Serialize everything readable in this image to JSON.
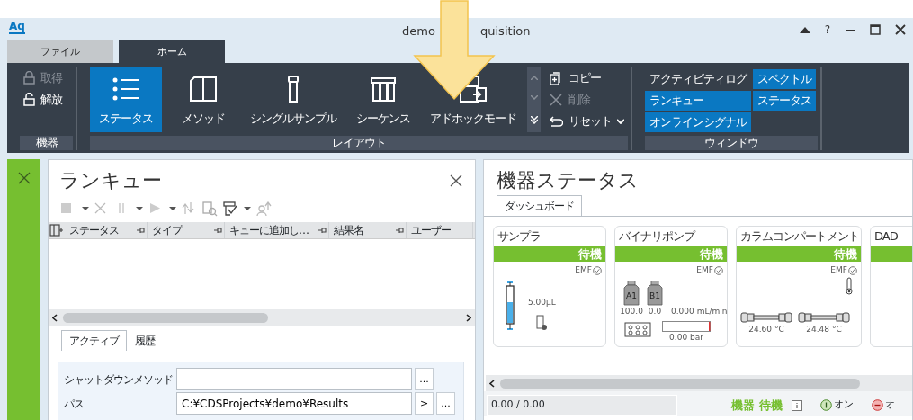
{
  "window": {
    "logo": "Aq",
    "title_left": "demo",
    "title_right": "quisition",
    "help": "?"
  },
  "ribbon_tabs": [
    {
      "label": "ファイル",
      "selected": false
    },
    {
      "label": "ホーム",
      "selected": true
    }
  ],
  "instrument_group": {
    "label": "機器",
    "items": [
      {
        "label": "取得",
        "disabled": true
      },
      {
        "label": "解放",
        "disabled": false
      }
    ]
  },
  "layout_group": {
    "label": "レイアウト",
    "layouts": [
      {
        "label": "ステータス",
        "selected": true
      },
      {
        "label": "メソッド",
        "selected": false
      },
      {
        "label": "シングルサンプル",
        "selected": false
      },
      {
        "label": "シーケンス",
        "selected": false
      },
      {
        "label": "アドホックモード",
        "selected": false
      }
    ],
    "actions": [
      {
        "label": "コピー",
        "disabled": false
      },
      {
        "label": "削除",
        "disabled": true
      },
      {
        "label": "リセット",
        "disabled": false
      }
    ]
  },
  "window_group": {
    "label": "ウィンドウ",
    "items": [
      {
        "label": "アクティビティログ",
        "on": false
      },
      {
        "label": "スペクトル",
        "on": true
      },
      {
        "label": "ランキュー",
        "on": true
      },
      {
        "label": "ステータス",
        "on": true
      },
      {
        "label": "オンラインシグナル",
        "on": true
      }
    ]
  },
  "run_queue": {
    "title": "ランキュー",
    "columns": [
      "ステータス",
      "タイプ",
      "キューに追加し…",
      "結果名",
      "ユーザー"
    ],
    "tabs": [
      {
        "label": "アクティブ",
        "selected": true
      },
      {
        "label": "履歴",
        "selected": false
      }
    ],
    "fields": [
      {
        "label": "シャットダウンメソッド",
        "buttons": [
          "..."
        ]
      },
      {
        "label": "パス",
        "value": "C:¥CDSProjects¥demo¥Results",
        "buttons": [
          ">",
          "..."
        ]
      }
    ]
  },
  "instrument_status": {
    "title": "機器ステータス",
    "tabs": [
      {
        "label": "ダッシュボード",
        "selected": true
      }
    ],
    "modules": [
      {
        "kind": "sampler",
        "name": "サンプラ",
        "state": "待機",
        "emf": "EMF",
        "volume": "5.00µL"
      },
      {
        "kind": "pump",
        "name": "バイナリポンプ",
        "state": "待機",
        "emf": "EMF",
        "bottles": [
          "A1",
          "B1"
        ],
        "percents": [
          "100.0",
          "0.0"
        ],
        "flow": "0.000 mL/min",
        "pressure": "0.00 bar"
      },
      {
        "kind": "column",
        "name": "カラムコンパートメント",
        "state": "待機",
        "emf": "EMF",
        "temps": [
          "24.60 °C",
          "24.48 °C"
        ]
      },
      {
        "kind": "detector",
        "name": "DAD"
      }
    ],
    "footer": {
      "progress": "0.00 / 0.00",
      "state": "機器 待機",
      "on_label": "オン",
      "off_label": "オ"
    }
  }
}
